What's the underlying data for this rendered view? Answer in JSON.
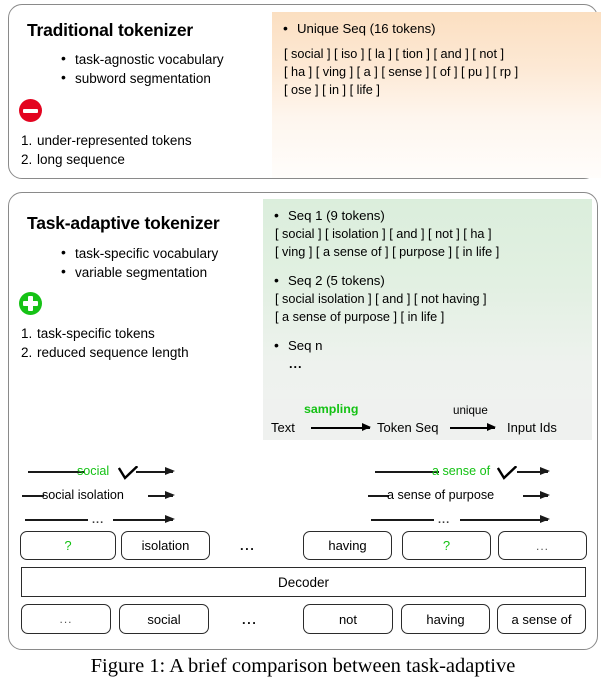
{
  "figure": {
    "caption": "Figure 1:  A brief comparison between task-adaptive"
  },
  "traditional": {
    "title": "Traditional tokenizer",
    "features": [
      "task-agnostic vocabulary",
      "subword segmentation"
    ],
    "badge_icon": "deny-icon",
    "drawbacks": [
      {
        "num": "1.",
        "text": "under-represented tokens"
      },
      {
        "num": "2.",
        "text": "long sequence"
      }
    ],
    "tokens_panel": {
      "heading": "Unique Seq (16 tokens)",
      "lines": [
        "[ social ] [ iso ] [ la ] [ tion ] [ and ] [ not ]",
        "[ ha ] [ ving ] [ a ] [ sense ] [ of ] [ pu ] [ rp ]",
        "[ ose ]  [ in ]  [ life ]"
      ]
    }
  },
  "adaptive": {
    "title": "Task-adaptive tokenizer",
    "features": [
      "task-specific vocabulary",
      "variable segmentation"
    ],
    "badge_icon": "plus-icon",
    "benefits": [
      {
        "num": "1.",
        "text": "task-specific tokens"
      },
      {
        "num": "2.",
        "text": "reduced sequence length"
      }
    ],
    "sequences": [
      {
        "heading": "Seq 1 (9 tokens)",
        "lines": [
          "[ social ] [ isolation ] [ and ] [ not ]  [ ha ]",
          "[ ving ]  [ a sense of ]  [ purpose ] [ in life ]"
        ]
      },
      {
        "heading": "Seq 2 (5 tokens)",
        "lines": [
          "[ social isolation ]  [ and ] [ not having ]",
          "[ a sense of purpose ]  [ in life ]"
        ]
      },
      {
        "heading": "Seq n",
        "lines": [
          "..."
        ]
      }
    ],
    "flow": {
      "source": "Text",
      "middle": "Token Seq",
      "target": "Input Ids",
      "edge1_label": "sampling",
      "edge2_label": "unique",
      "sampling_color": "#14c214"
    }
  },
  "decoder_stage": {
    "left_candidates": {
      "row1": "social",
      "row2": "social isolation",
      "row3_dots": "..."
    },
    "right_candidates": {
      "row1": "a sense of",
      "row2": "a sense of purpose",
      "row3_dots": "..."
    },
    "output_row": [
      {
        "text": "?",
        "style": "q"
      },
      {
        "text": "isolation",
        "style": "plain"
      },
      {
        "text": "having",
        "style": "plain"
      },
      {
        "text": "?",
        "style": "q"
      },
      {
        "text": "...",
        "style": "dots"
      }
    ],
    "output_gap_dots": "...",
    "decoder_label": "Decoder",
    "input_row": [
      {
        "text": "...",
        "style": "dots"
      },
      {
        "text": "social",
        "style": "plain"
      },
      {
        "text": "not",
        "style": "plain"
      },
      {
        "text": "having",
        "style": "plain"
      },
      {
        "text": "a sense of",
        "style": "plain"
      }
    ],
    "input_gap_dots": "..."
  }
}
